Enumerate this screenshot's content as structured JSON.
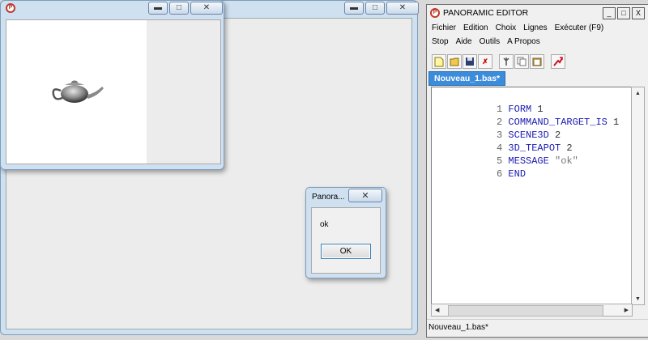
{
  "editor": {
    "title": "PANORAMIC EDITOR",
    "window_buttons": [
      "_",
      "□",
      "X"
    ],
    "menu_row1": [
      "Fichier",
      "Edition",
      "Choix",
      "Lignes",
      "Exécuter (F9)"
    ],
    "menu_row2": [
      "Stop",
      "Aide",
      "Outils",
      "A Propos"
    ],
    "toolbar_icons": [
      "new-file-icon",
      "open-folder-icon",
      "save-icon",
      "delete-icon",
      "tools-icon",
      "copy-icon",
      "paste-icon",
      "run-icon"
    ],
    "tab_label": "Nouveau_1.bas*",
    "code_lines": [
      {
        "num": "1",
        "keyword": "FORM",
        "arg": " 1"
      },
      {
        "num": "2",
        "keyword": "COMMAND_TARGET_IS",
        "arg": " 1"
      },
      {
        "num": "3",
        "keyword": "SCENE3D",
        "arg": " 2"
      },
      {
        "num": "4",
        "keyword": "3D_TEAPOT",
        "arg": " 2"
      },
      {
        "num": "5",
        "keyword": "MESSAGE",
        "arg": " \"ok\""
      },
      {
        "num": "6",
        "keyword": "END",
        "arg": ""
      }
    ],
    "status_text": "Nouveau_1.bas*"
  },
  "message_box": {
    "title": "Panora...",
    "message": "ok",
    "ok_label": "OK"
  },
  "teapot_window": {
    "icon": "teapot-icon"
  },
  "colors": {
    "keyword": "#1b1bb3",
    "tab_active": "#3c8cdc",
    "window_frame": "#cfe0f1"
  }
}
